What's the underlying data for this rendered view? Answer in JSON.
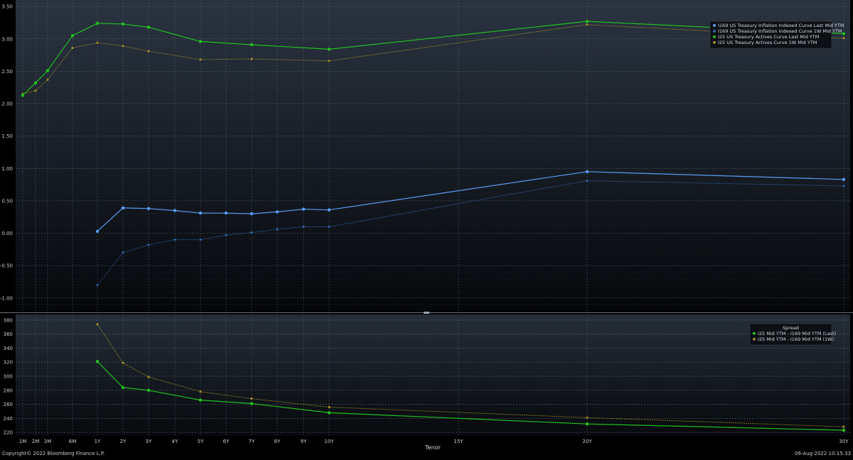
{
  "chart_data": [
    {
      "type": "line",
      "xlabel": "Tenor",
      "x_tenors_years": [
        0.0833,
        0.1667,
        0.25,
        0.5,
        1,
        2,
        3,
        4,
        5,
        6,
        7,
        8,
        9,
        10,
        20,
        30
      ],
      "x_tick_labels": [
        {
          "label": "1M",
          "years": 0.0833
        },
        {
          "label": "2M",
          "years": 0.1667
        },
        {
          "label": "3M",
          "years": 0.25
        },
        {
          "label": "6M",
          "years": 0.5
        },
        {
          "label": "1Y",
          "years": 1
        },
        {
          "label": "2Y",
          "years": 2
        },
        {
          "label": "3Y",
          "years": 3
        },
        {
          "label": "4Y",
          "years": 4
        },
        {
          "label": "5Y",
          "years": 5
        },
        {
          "label": "6Y",
          "years": 6
        },
        {
          "label": "7Y",
          "years": 7
        },
        {
          "label": "8Y",
          "years": 8
        },
        {
          "label": "9Y",
          "years": 9
        },
        {
          "label": "10Y",
          "years": 10
        },
        {
          "label": "15Y",
          "years": 15
        },
        {
          "label": "20Y",
          "years": 20
        },
        {
          "label": "30Y",
          "years": 30
        }
      ],
      "ylim": [
        -1.2,
        3.6
      ],
      "y_ticks": [
        "3.50",
        "3.00",
        "2.50",
        "2.00",
        "1.50",
        "1.00",
        "0.50",
        "0.00",
        "-0.50",
        "-1.00"
      ],
      "y_tick_values": [
        3.5,
        3.0,
        2.5,
        2.0,
        1.5,
        1.0,
        0.5,
        0.0,
        -0.5,
        -1.0
      ],
      "grid": true,
      "legend_position": "top-right",
      "series": [
        {
          "name": "I169 US Treasury Inflation Indexed Curve Last Mid YTM",
          "color": "#5b9bf0",
          "style": "solid",
          "x": [
            1,
            2,
            3,
            4,
            5,
            6,
            7,
            8,
            9,
            10,
            20,
            30
          ],
          "values": [
            0.03,
            0.39,
            0.38,
            0.35,
            0.31,
            0.31,
            0.3,
            0.33,
            0.37,
            0.36,
            0.95,
            0.83
          ]
        },
        {
          "name": "I169 US Treasury Inflation Indexed Curve 1W Mid YTM",
          "color": "#2f5fa8",
          "style": "dotted",
          "x": [
            1,
            2,
            3,
            4,
            5,
            6,
            7,
            8,
            9,
            10,
            20,
            30
          ],
          "values": [
            -0.8,
            -0.3,
            -0.18,
            -0.1,
            -0.1,
            -0.03,
            0.01,
            0.06,
            0.1,
            0.1,
            0.81,
            0.73
          ]
        },
        {
          "name": "I25 US Treasury Actives Curve Last Mid YTM",
          "color": "#22c022",
          "style": "solid",
          "x": [
            0.0833,
            0.1667,
            0.25,
            0.5,
            1,
            2,
            3,
            5,
            7,
            10,
            20,
            30
          ],
          "values": [
            2.13,
            2.32,
            2.51,
            3.05,
            3.24,
            3.23,
            3.18,
            2.96,
            2.91,
            2.84,
            3.27,
            3.08
          ]
        },
        {
          "name": "I25 US Treasury Actives Curve 1W Mid YTM",
          "color": "#a08a2a",
          "style": "dotted",
          "x": [
            0.0833,
            0.1667,
            0.25,
            0.5,
            1,
            2,
            3,
            5,
            7,
            10,
            20,
            30
          ],
          "values": [
            2.15,
            2.2,
            2.37,
            2.86,
            2.94,
            2.89,
            2.81,
            2.68,
            2.69,
            2.66,
            3.22,
            3.01
          ]
        }
      ]
    },
    {
      "type": "line",
      "legend_title": "Spread",
      "ylim": [
        215,
        388
      ],
      "y_ticks": [
        "380",
        "360",
        "340",
        "320",
        "300",
        "280",
        "260",
        "240",
        "220"
      ],
      "y_tick_values": [
        380,
        360,
        340,
        320,
        300,
        280,
        260,
        240,
        220
      ],
      "grid": true,
      "legend_position": "top-right",
      "series": [
        {
          "name": "I25 Mid YTM - I169 Mid YTM (Last)",
          "color": "#22c022",
          "style": "solid",
          "x": [
            1,
            2,
            3,
            5,
            7,
            10,
            20,
            30
          ],
          "values": [
            321,
            284,
            280,
            266,
            261,
            248,
            232,
            223
          ]
        },
        {
          "name": "I25 Mid YTM - I169 Mid YTM (1W)",
          "color": "#a08a2a",
          "style": "dotted",
          "x": [
            1,
            2,
            3,
            5,
            7,
            10,
            20,
            30
          ],
          "values": [
            374,
            319,
            299,
            278,
            268,
            256,
            241,
            228
          ]
        }
      ]
    }
  ],
  "footer": {
    "copyright": "Copyright© 2022 Bloomberg Finance L.P.",
    "timestamp": "06-Aug-2022 10:15:33"
  }
}
